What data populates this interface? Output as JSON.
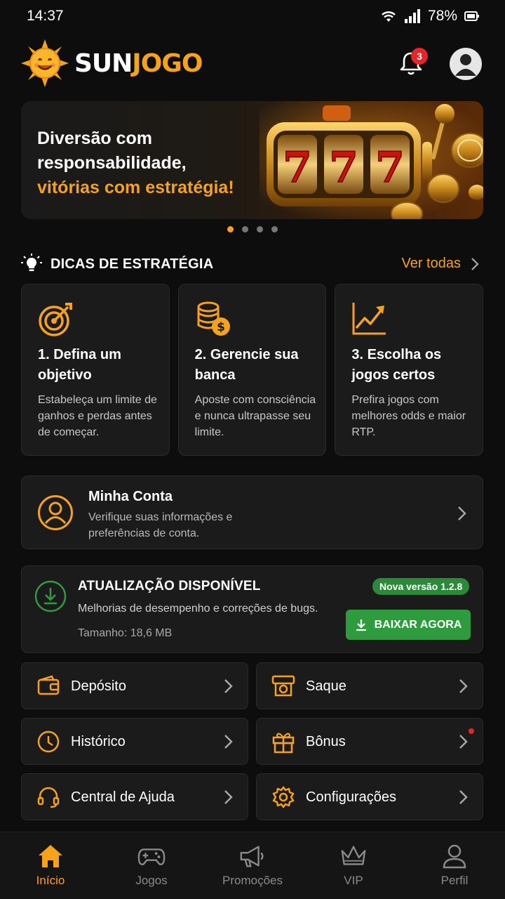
{
  "status": {
    "time": "14:37",
    "battery": "78%"
  },
  "header": {
    "brand_part1": "SUN",
    "brand_part2": "JOGO",
    "notification_count": "3"
  },
  "banner": {
    "line1": "Diversão com",
    "line2": "responsabilidade,",
    "line3": "vitórias com estratégia!",
    "slot_digit": "7",
    "active_slide": 1,
    "slides": 4
  },
  "tips": {
    "title": "DICAS DE ESTRATÉGIA",
    "see_all": "Ver todas",
    "items": [
      {
        "icon": "target-icon",
        "title": "1. Defina um objetivo",
        "desc": "Estabeleça um limite de ganhos e perdas antes de começar."
      },
      {
        "icon": "coins-icon",
        "title": "2. Gerencie sua banca",
        "desc": "Aposte com consciência e nunca ultrapasse seu limite."
      },
      {
        "icon": "chart-up-icon",
        "title": "3. Escolha os jogos certos",
        "desc": "Prefira jogos com melhores odds e maior RTP."
      }
    ]
  },
  "account": {
    "title": "Minha Conta",
    "subtitle": "Verifique suas informações e preferências de conta."
  },
  "update": {
    "title": "ATUALIZAÇÃO DISPONÍVEL",
    "description": "Melhorias de desempenho e correções de bugs.",
    "size": "Tamanho: 18,6 MB",
    "version": "Nova versão 1.2.8",
    "button": "BAIXAR AGORA"
  },
  "menu": [
    {
      "label": "Depósito",
      "icon": "wallet-icon"
    },
    {
      "label": "Saque",
      "icon": "withdraw-icon"
    },
    {
      "label": "Histórico",
      "icon": "clock-icon"
    },
    {
      "label": "Bônus",
      "icon": "gift-icon"
    },
    {
      "label": "Central de Ajuda",
      "icon": "headset-icon"
    },
    {
      "label": "Configurações",
      "icon": "gear-icon"
    }
  ],
  "nav": [
    {
      "label": "Início",
      "icon": "home-icon"
    },
    {
      "label": "Jogos",
      "icon": "gamepad-icon"
    },
    {
      "label": "Promoções",
      "icon": "megaphone-icon"
    },
    {
      "label": "VIP",
      "icon": "crown-icon"
    },
    {
      "label": "Perfil",
      "icon": "user-icon"
    }
  ],
  "colors": {
    "accent": "#f7a21b",
    "green": "#2e9b3f",
    "badge": "#e8232a",
    "card": "#1b1b1b"
  }
}
